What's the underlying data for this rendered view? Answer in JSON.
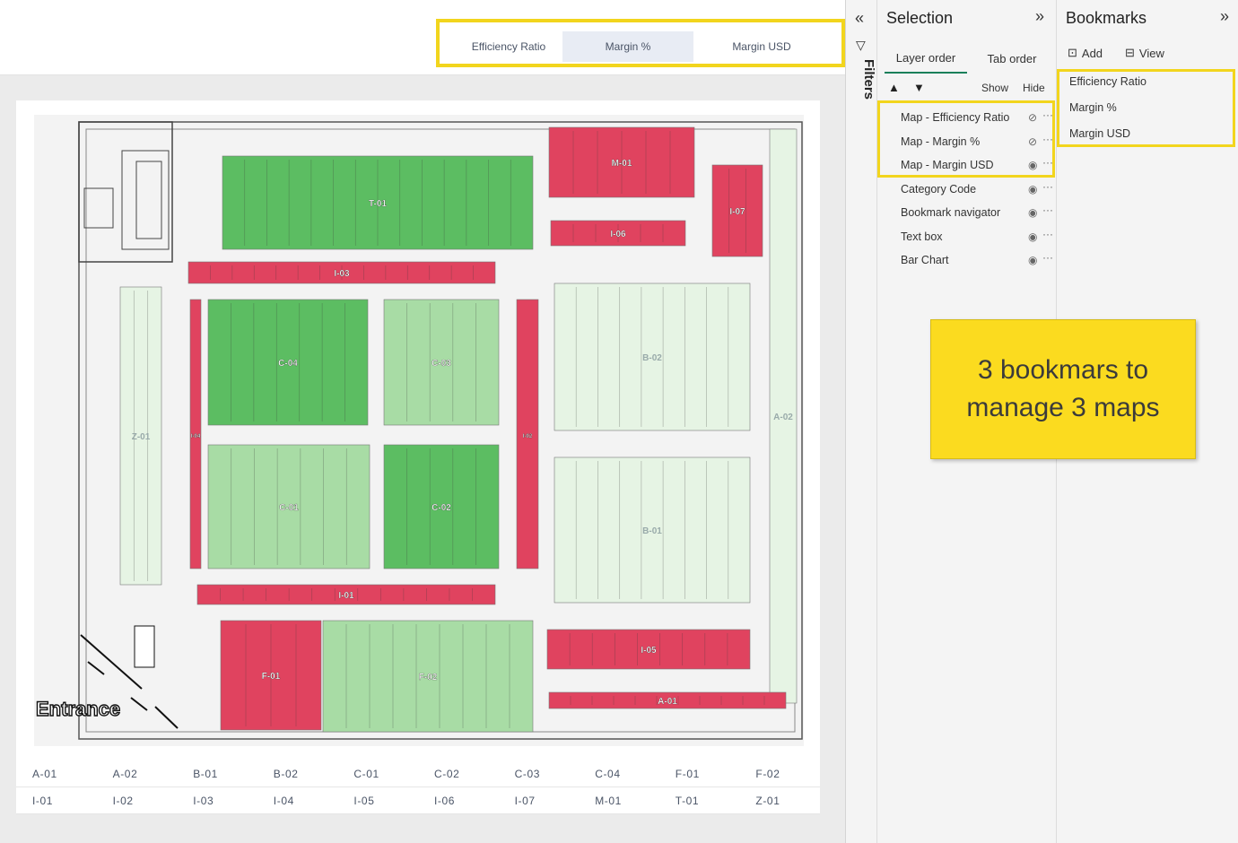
{
  "nav": {
    "buttons": [
      {
        "label": "Efficiency Ratio"
      },
      {
        "label": "Margin %"
      },
      {
        "label": "Margin USD"
      }
    ],
    "active": "Margin %"
  },
  "map": {
    "entrance_label": "Entrance",
    "zones": [
      {
        "id": "T-01",
        "status": "green"
      },
      {
        "id": "M-01",
        "status": "red"
      },
      {
        "id": "I-07",
        "status": "red"
      },
      {
        "id": "I-06",
        "status": "red"
      },
      {
        "id": "I-03",
        "status": "red"
      },
      {
        "id": "C-04",
        "status": "green"
      },
      {
        "id": "C-03",
        "status": "lightgreen"
      },
      {
        "id": "B-02",
        "status": "palegreen"
      },
      {
        "id": "A-02",
        "status": "palegreen"
      },
      {
        "id": "Z-01",
        "status": "palegreen"
      },
      {
        "id": "I-04",
        "status": "red"
      },
      {
        "id": "I-02",
        "status": "red"
      },
      {
        "id": "C-01",
        "status": "lightgreen"
      },
      {
        "id": "C-02",
        "status": "green"
      },
      {
        "id": "B-01",
        "status": "palegreen"
      },
      {
        "id": "I-01",
        "status": "red"
      },
      {
        "id": "F-01",
        "status": "red"
      },
      {
        "id": "F-02",
        "status": "lightgreen"
      },
      {
        "id": "I-05",
        "status": "red"
      },
      {
        "id": "A-01",
        "status": "red"
      }
    ],
    "colors": {
      "red": "#e0435f",
      "green": "#5cbd62",
      "lightgreen": "#a8dca5",
      "palegreen": "#e6f4e4"
    }
  },
  "legend_table": {
    "row1": [
      "A-01",
      "A-02",
      "B-01",
      "B-02",
      "C-01",
      "C-02",
      "C-03",
      "C-04",
      "F-01",
      "F-02"
    ],
    "row2": [
      "I-01",
      "I-02",
      "I-03",
      "I-04",
      "I-05",
      "I-06",
      "I-07",
      "M-01",
      "T-01",
      "Z-01"
    ]
  },
  "filters": {
    "label": "Filters"
  },
  "selection": {
    "title": "Selection",
    "tabs": [
      "Layer order",
      "Tab order"
    ],
    "show_label": "Show",
    "hide_label": "Hide",
    "layers": [
      {
        "label": "Map - Efficiency Ratio",
        "visible": false
      },
      {
        "label": "Map - Margin %",
        "visible": false
      },
      {
        "label": "Map - Margin USD",
        "visible": true
      },
      {
        "label": "Category Code",
        "visible": true
      },
      {
        "label": "Bookmark navigator",
        "visible": true
      },
      {
        "label": "Text box",
        "visible": true
      },
      {
        "label": "Bar Chart",
        "visible": true
      }
    ]
  },
  "bookmarks": {
    "title": "Bookmarks",
    "add_label": "Add",
    "view_label": "View",
    "items": [
      "Efficiency Ratio",
      "Margin %",
      "Margin USD"
    ]
  },
  "callout": {
    "text": "3 bookmars to manage 3 maps"
  },
  "accent": {
    "highlight": "#f2d51d",
    "tab_underline": "#1a7f5a"
  }
}
